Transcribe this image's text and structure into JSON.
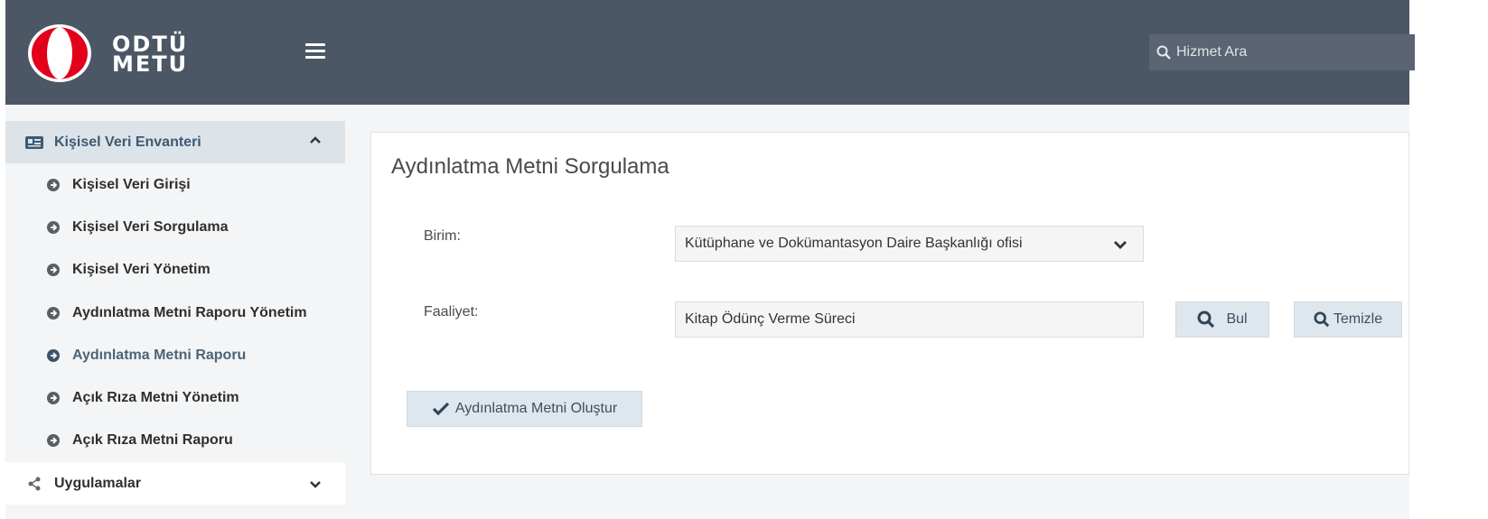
{
  "header": {
    "logo_line1": "ODTÜ",
    "logo_line2": "METU",
    "search_placeholder": "Hizmet Ara"
  },
  "sidebar": {
    "section_title": "Kişisel Veri Envanteri",
    "items": [
      {
        "label": "Kişisel Veri Girişi"
      },
      {
        "label": "Kişisel Veri Sorgulama"
      },
      {
        "label": "Kişisel Veri Yönetim"
      },
      {
        "label": "Aydınlatma Metni Raporu Yönetim"
      },
      {
        "label": "Aydınlatma Metni Raporu",
        "active": true
      },
      {
        "label": "Açık Rıza Metni Yönetim"
      },
      {
        "label": "Açık Rıza Metni Raporu"
      }
    ],
    "next_section": "Uygulamalar"
  },
  "main": {
    "title": "Aydınlatma Metni Sorgulama",
    "birim_label": "Birim:",
    "birim_value": "Kütüphane ve Dokümantasyon Daire Başkanlığı ofisi",
    "faaliyet_label": "Faaliyet:",
    "faaliyet_value": "Kitap Ödünç Verme Süreci",
    "find_button": "Bul",
    "clear_button": "Temizle",
    "create_button": "Aydınlatma Metni Oluştur"
  },
  "colors": {
    "header_bg": "#4c5766",
    "sidebar_header_bg": "#dce4ea",
    "button_bg": "#dfe7ee",
    "logo_red": "#e2001a"
  }
}
